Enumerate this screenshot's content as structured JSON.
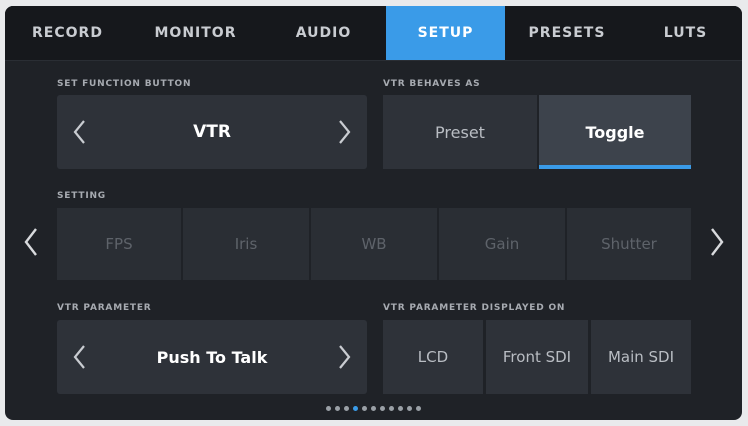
{
  "tabs": [
    {
      "label": "RECORD",
      "active": false
    },
    {
      "label": "MONITOR",
      "active": false
    },
    {
      "label": "AUDIO",
      "active": false
    },
    {
      "label": "SETUP",
      "active": true
    },
    {
      "label": "PRESETS",
      "active": false
    },
    {
      "label": "LUTS",
      "active": false
    }
  ],
  "function_button": {
    "label": "SET FUNCTION BUTTON",
    "value": "VTR",
    "prev_icon": "chevron-left-icon",
    "next_icon": "chevron-right-icon"
  },
  "vtr_behaves_as": {
    "label": "VTR BEHAVES AS",
    "options": [
      {
        "label": "Preset",
        "selected": false
      },
      {
        "label": "Toggle",
        "selected": true
      }
    ]
  },
  "setting": {
    "label": "SETTING",
    "options": [
      "FPS",
      "Iris",
      "WB",
      "Gain",
      "Shutter"
    ],
    "enabled": false,
    "prev_icon": "chevron-left-icon",
    "next_icon": "chevron-right-icon"
  },
  "vtr_parameter": {
    "label": "VTR PARAMETER",
    "value": "Push To Talk"
  },
  "vtr_parameter_displayed_on": {
    "label": "VTR PARAMETER DISPLAYED ON",
    "options": [
      "LCD",
      "Front SDI",
      "Main SDI"
    ]
  },
  "pagination": {
    "total": 11,
    "current": 4
  },
  "colors": {
    "accent": "#3a9be8",
    "panel": "#2e3239",
    "background": "#1f2227"
  }
}
